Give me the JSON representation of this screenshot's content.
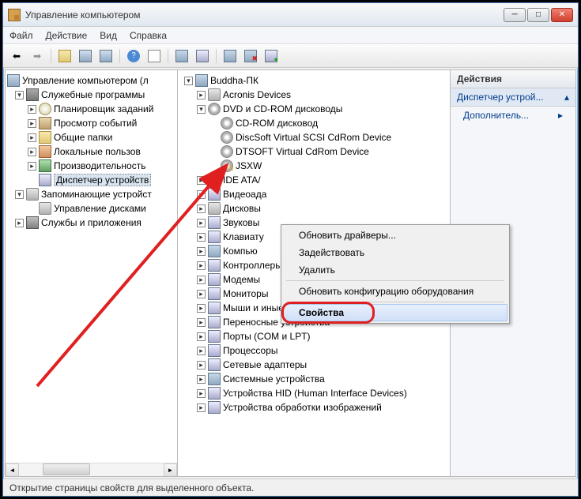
{
  "title": "Управление компьютером",
  "menu": {
    "file": "Файл",
    "action": "Действие",
    "view": "Вид",
    "help": "Справка"
  },
  "left_tree": {
    "root": "Управление компьютером (л",
    "services_group": "Служебные программы",
    "scheduler": "Планировщик заданий",
    "event_viewer": "Просмотр событий",
    "shared_folders": "Общие папки",
    "local_users": "Локальные пользов",
    "performance": "Производительность",
    "device_manager": "Диспетчер устройств",
    "storage": "Запоминающие устройст",
    "disk_mgmt": "Управление дисками",
    "services_apps": "Службы и приложения"
  },
  "center_tree": {
    "root": "Buddha-ПК",
    "acronis": "Acronis Devices",
    "dvd": "DVD и CD-ROM дисководы",
    "cdrom": "CD-ROM дисковод",
    "discsoft": "DiscSoft Virtual SCSI CdRom Device",
    "dtsoft": "DTSOFT Virtual CdRom Device",
    "jsxw": "JSXW",
    "ide": "IDE ATA/",
    "video": "Видеоада",
    "disk_dev": "Дисковы",
    "audio": "Звуковы",
    "keyboard": "Клавиату",
    "computer": "Компью",
    "storage_ctrl": "Контроллеры запоминающих устройств",
    "modems": "Модемы",
    "monitors": "Мониторы",
    "mice": "Мыши и иные указывающие устройства",
    "portable": "Переносные устройства",
    "ports": "Порты (COM и LPT)",
    "processors": "Процессоры",
    "network": "Сетевые адаптеры",
    "system_dev": "Системные устройства",
    "hid": "Устройства HID (Human Interface Devices)",
    "imaging": "Устройства обработки изображений"
  },
  "context_menu": {
    "update_drivers": "Обновить драйверы...",
    "enable": "Задействовать",
    "delete": "Удалить",
    "scan": "Обновить конфигурацию оборудования",
    "properties": "Свойства"
  },
  "actions": {
    "header": "Действия",
    "device_manager": "Диспетчер устрой...",
    "additional": "Дополнитель..."
  },
  "status": "Открытие страницы свойств для выделенного объекта."
}
